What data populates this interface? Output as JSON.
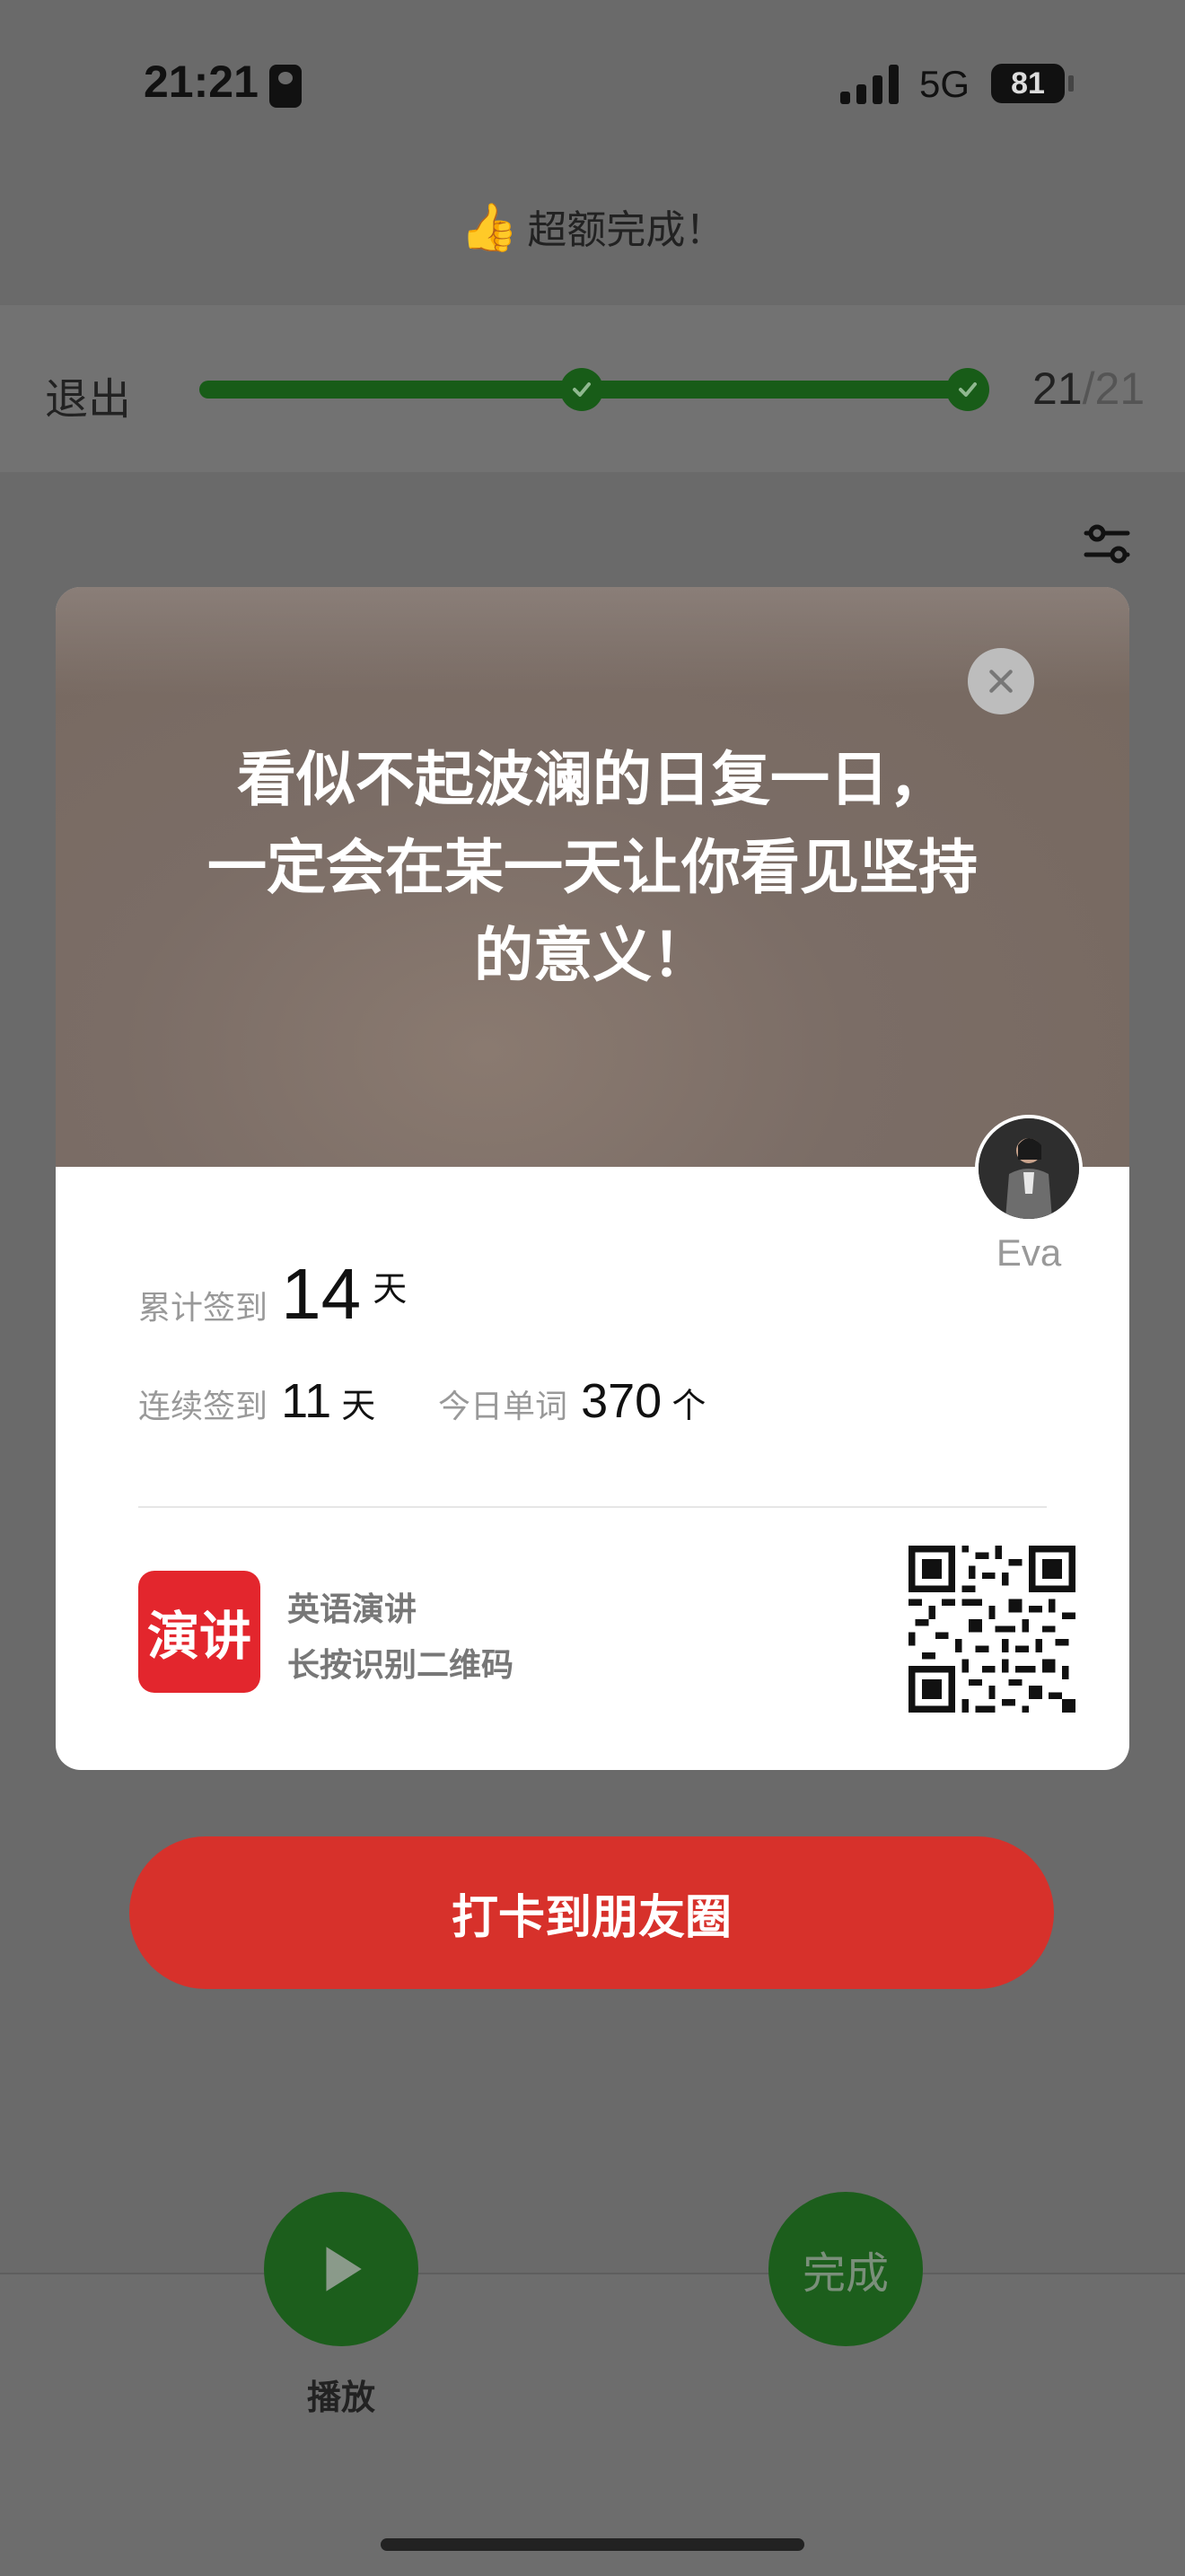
{
  "status_bar": {
    "time": "21:21",
    "network": "5G",
    "battery": "81"
  },
  "header": {
    "banner_text": "超额完成！",
    "exit_label": "退出",
    "progress_current": "21",
    "progress_total": "/21"
  },
  "card": {
    "quote_lines": [
      "看似不起波澜的日复一日，",
      "一定会在某一天让你看见坚持",
      "的意义！"
    ],
    "user": {
      "name": "Eva"
    },
    "stats": {
      "total_label": "累计签到",
      "total_value": "14",
      "total_unit": "天",
      "streak_label": "连续签到",
      "streak_value": "11",
      "streak_unit": "天",
      "words_label": "今日单词",
      "words_value": "370",
      "words_unit": "个"
    },
    "app": {
      "logo_text": "演讲",
      "name": "英语演讲",
      "subtitle": "长按识别二维码"
    }
  },
  "share_button": "打卡到朋友圈",
  "bottom": {
    "play_label": "播放",
    "done_label": "完成"
  },
  "colors": {
    "accent_green": "#185c18",
    "share_red": "#d7312b",
    "logo_red": "#e3262d"
  }
}
